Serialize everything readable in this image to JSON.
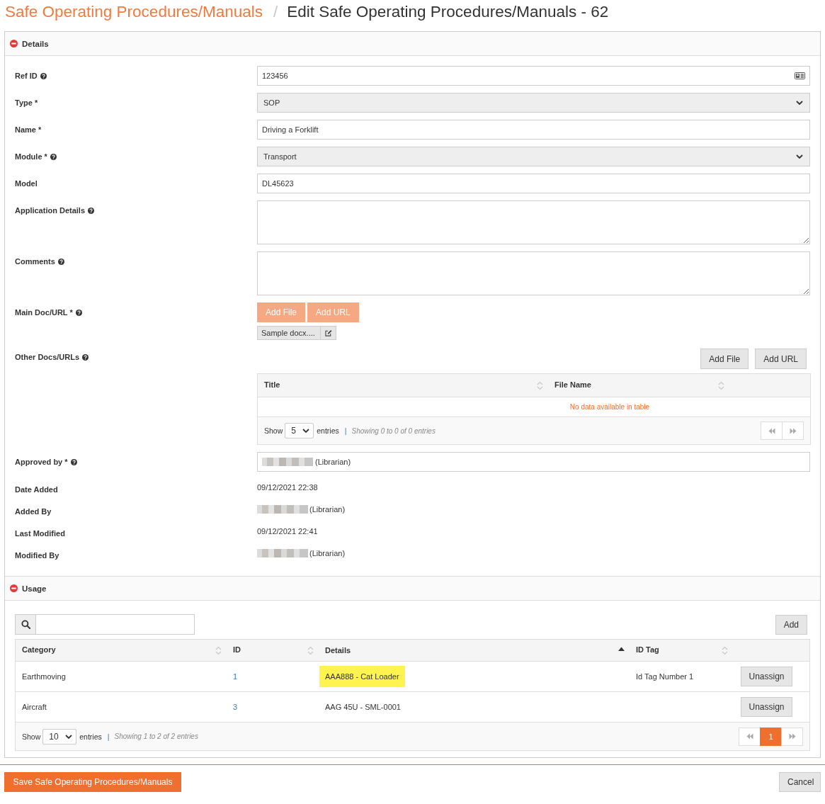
{
  "breadcrumb": {
    "parent": "Safe Operating Procedures/Manuals",
    "separator": "/",
    "current": "Edit Safe Operating Procedures/Manuals - 62"
  },
  "details": {
    "title": "Details",
    "expanded": true,
    "fields": [
      {
        "kind": "lookup",
        "label": "Ref ID",
        "help": true,
        "value": "123456"
      },
      {
        "kind": "select",
        "label": "Type *",
        "help": false,
        "value": "SOP"
      },
      {
        "kind": "text",
        "label": "Name *",
        "help": false,
        "value": "Driving a Forklift"
      },
      {
        "kind": "select",
        "label": "Module *",
        "help": true,
        "value": "Transport"
      },
      {
        "kind": "text",
        "label": "Model",
        "help": false,
        "value": "DL45623"
      },
      {
        "kind": "textarea",
        "label": "Application Details",
        "help": true
      },
      {
        "kind": "textarea",
        "label": "Comments",
        "help": true
      },
      {
        "kind": "files",
        "label": "Main Doc/URL *",
        "help": true,
        "buttons": [
          {
            "label": "Add File",
            "disabled": true
          },
          {
            "label": "Add URL",
            "disabled": true
          }
        ],
        "file": "Sample docx...."
      },
      {
        "kind": "doc_table",
        "label": "Other Docs/URLs",
        "help": true,
        "buttons": [
          {
            "label": "Add File",
            "disabled": false
          },
          {
            "label": "Add URL",
            "disabled": false
          }
        ],
        "table": {
          "columns": [
            {
              "label": "Title",
              "sorted": false
            },
            {
              "label": "File Name",
              "sorted": false
            }
          ],
          "empty_message": "No data available in table",
          "footer": {
            "show_label": "Show",
            "page_size": "5",
            "entries_label": "entries",
            "separator": "|",
            "info": "Showing 0 to 0 of 0 entries"
          }
        }
      },
      {
        "kind": "person",
        "label": "Approved by *",
        "help": true,
        "value": "(Librarian)",
        "redacted": true
      },
      {
        "kind": "static",
        "label": "Date Added",
        "help": false,
        "value": "09/12/2021 22:38",
        "redacted": false
      },
      {
        "kind": "static",
        "label": "Added By",
        "help": false,
        "value": "(Librarian)",
        "redacted": true
      },
      {
        "kind": "static",
        "label": "Last Modified",
        "help": false,
        "value": "09/12/2021 22:41",
        "redacted": false
      },
      {
        "kind": "static",
        "label": "Modified By",
        "help": false,
        "value": "(Librarian)",
        "redacted": true
      }
    ]
  },
  "usage": {
    "title": "Usage",
    "expanded": true,
    "add_button": "Add",
    "table": {
      "columns": [
        {
          "label": "Category",
          "sorted": false
        },
        {
          "label": "ID",
          "sorted": false
        },
        {
          "label": "Details",
          "sorted": true,
          "descending": false
        },
        {
          "label": "ID Tag",
          "sorted": false
        }
      ],
      "rows": [
        {
          "category": "Earthmoving",
          "id": "1",
          "details": "AAA888 - Cat Loader",
          "highlighted": true,
          "id_tag": "Id Tag Number 1",
          "action": "Unassign"
        },
        {
          "category": "Aircraft",
          "id": "3",
          "details": "AAG 45U - SML-0001",
          "highlighted": false,
          "action": "Unassign"
        }
      ],
      "footer": {
        "show_label": "Show",
        "page_size": "10",
        "entries_label": "entries",
        "separator": "|",
        "info": "Showing 1 to 2 of 2 entries"
      },
      "pages": [
        {
          "label": "1",
          "selected": true
        }
      ]
    }
  },
  "actions": {
    "save": "Save Safe Operating Procedures/Manuals",
    "cancel": "Cancel"
  }
}
